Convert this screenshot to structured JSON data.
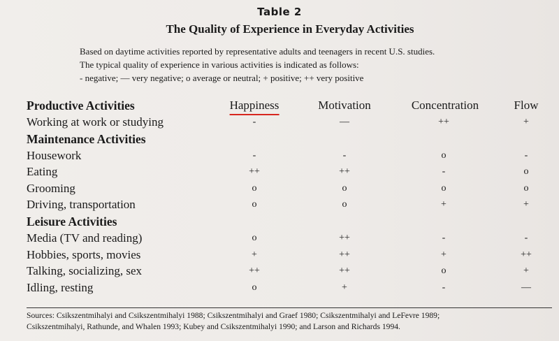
{
  "title": "Table 2",
  "subtitle": "The Quality of Experience in Everyday Activities",
  "intro": [
    "Based on daytime activities reported by representative adults and teenagers in recent U.S. studies.",
    "The typical quality of experience in various activities is indicated as follows:",
    "- negative;  — very negative;  o average or neutral;  + positive;  ++ very positive"
  ],
  "columns": [
    "Happiness",
    "Motivation",
    "Concentration",
    "Flow"
  ],
  "sections": [
    {
      "name": "Productive Activities",
      "rows": [
        {
          "label": "Working at work or studying",
          "values": [
            "-",
            "—",
            "++",
            "+"
          ]
        }
      ]
    },
    {
      "name": "Maintenance Activities",
      "rows": [
        {
          "label": "Housework",
          "values": [
            "-",
            "-",
            "o",
            "-"
          ]
        },
        {
          "label": "Eating",
          "values": [
            "++",
            "++",
            "-",
            "o"
          ]
        },
        {
          "label": "Grooming",
          "values": [
            "o",
            "o",
            "o",
            "o"
          ]
        },
        {
          "label": "Driving, transportation",
          "values": [
            "o",
            "o",
            "+",
            "+"
          ]
        }
      ]
    },
    {
      "name": "Leisure Activities",
      "rows": [
        {
          "label": "Media (TV and reading)",
          "values": [
            "o",
            "++",
            "-",
            "-"
          ]
        },
        {
          "label": "Hobbies, sports, movies",
          "values": [
            "+",
            "++",
            "+",
            "++"
          ]
        },
        {
          "label": "Talking, socializing, sex",
          "values": [
            "++",
            "++",
            "o",
            "+"
          ]
        },
        {
          "label": "Idling, resting",
          "values": [
            "o",
            "+",
            "-",
            "—"
          ]
        }
      ]
    }
  ],
  "sources": [
    "Sources: Csikszentmihalyi and Csikszentmihalyi 1988; Csikszentmihalyi and Graef 1980; Csikszentmihalyi and LeFevre 1989;",
    "Csikszentmihalyi, Rathunde, and Whalen 1993; Kubey and Csikszentmihalyi 1990; and Larson and Richards 1994."
  ],
  "colors": {
    "underline": "#d7261e",
    "paper": "#eeeae7",
    "ink": "#1a1a1a"
  }
}
